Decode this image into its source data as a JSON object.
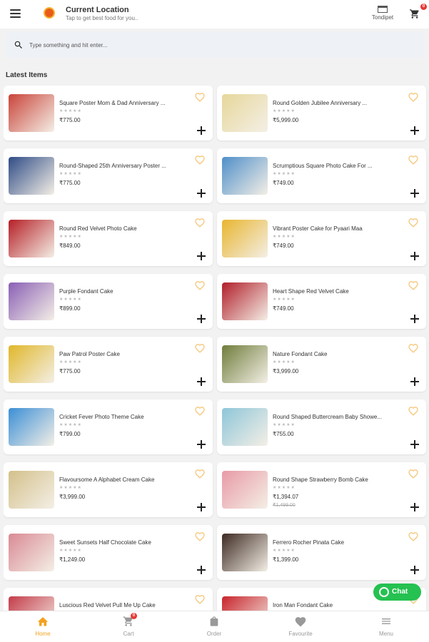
{
  "header": {
    "location_title": "Current Location",
    "location_sub": "Tap to get best food for you..",
    "store_label": "Tondipet",
    "cart_badge": "0"
  },
  "search": {
    "placeholder": "Type something and hit enter..."
  },
  "section_title": "Latest Items",
  "rating_stars": "★★★★★",
  "products": [
    {
      "name": "Square Poster Mom & Dad Anniversary ...",
      "price": "₹775.00",
      "thumb_color": "#c9443a"
    },
    {
      "name": "Round Golden Jubilee Anniversary ...",
      "price": "₹5,999.00",
      "thumb_color": "#e6d79a"
    },
    {
      "name": "Round-Shaped 25th Anniversary Poster ...",
      "price": "₹775.00",
      "thumb_color": "#2f4c86"
    },
    {
      "name": "Scrumptious Square Photo Cake For ...",
      "price": "₹749.00",
      "thumb_color": "#4f8fc9"
    },
    {
      "name": "Round Red Velvet Photo Cake",
      "price": "₹849.00",
      "thumb_color": "#b51f26"
    },
    {
      "name": "Vibrant Poster Cake for Pyaari Maa",
      "price": "₹749.00",
      "thumb_color": "#e8b52f"
    },
    {
      "name": "Purple Fondant Cake",
      "price": "₹899.00",
      "thumb_color": "#8a5fb5"
    },
    {
      "name": "Heart Shape Red Velvet Cake",
      "price": "₹749.00",
      "thumb_color": "#b01e2a"
    },
    {
      "name": "Paw Patrol Poster Cake",
      "price": "₹775.00",
      "thumb_color": "#e0b72a"
    },
    {
      "name": "Nature Fondant Cake",
      "price": "₹3,999.00",
      "thumb_color": "#6f7d3b"
    },
    {
      "name": "Cricket Fever Photo Theme Cake",
      "price": "₹799.00",
      "thumb_color": "#3b8fd6"
    },
    {
      "name": "Round Shaped Buttercream Baby Showe...",
      "price": "₹755.00",
      "thumb_color": "#8ec6d9"
    },
    {
      "name": "Flavoursome A Alphabet Cream Cake",
      "price": "₹3,999.00",
      "thumb_color": "#d3c08a"
    },
    {
      "name": "Round Shape Strawberry Bomb Cake",
      "price": "₹1,394.07",
      "old_price": "₹1,499.00",
      "thumb_color": "#e89aa6"
    },
    {
      "name": "Sweet Sunsets Half Chocolate Cake",
      "price": "₹1,249.00",
      "thumb_color": "#d98a94"
    },
    {
      "name": "Ferrero Rocher Pinata Cake",
      "price": "₹1,399.00",
      "thumb_color": "#3d2a22"
    },
    {
      "name": "Luscious Red Velvet Pull Me Up Cake",
      "price": "",
      "thumb_color": "#c43c4a"
    },
    {
      "name": "Iron Man Fondant Cake",
      "price": "",
      "thumb_color": "#c8242c"
    }
  ],
  "chat_label": "Chat",
  "bottom_nav": {
    "home": "Home",
    "cart": "Cart",
    "cart_badge": "0",
    "order": "Order",
    "favourite": "Favourite",
    "menu": "Menu"
  },
  "colors": {
    "accent": "#f2a21f",
    "heart": "#f5c77a",
    "chat": "#25c151",
    "badge": "#e53935"
  }
}
